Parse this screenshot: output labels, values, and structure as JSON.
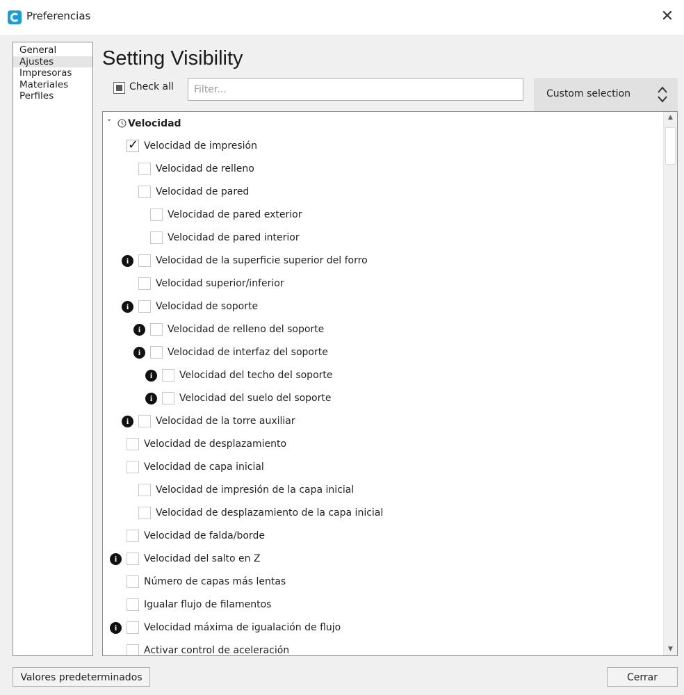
{
  "window": {
    "title": "Preferencias",
    "close_symbol": "✕"
  },
  "sidebar": {
    "items": [
      {
        "label": "General",
        "selected": false
      },
      {
        "label": "Ajustes",
        "selected": true
      },
      {
        "label": "Impresoras",
        "selected": false
      },
      {
        "label": "Materiales",
        "selected": false
      },
      {
        "label": "Perfiles",
        "selected": false
      }
    ]
  },
  "main": {
    "title": "Setting Visibility",
    "check_all_label": "Check all",
    "check_all_state": "partial",
    "filter_placeholder": "Filter...",
    "filter_value": "",
    "preset_value": "Custom selection"
  },
  "category": {
    "label": "Velocidad",
    "expanded": true,
    "icon": "clock-icon"
  },
  "settings": [
    {
      "label": "Velocidad de impresión",
      "checked": true,
      "info": false,
      "depth": 0
    },
    {
      "label": "Velocidad de relleno",
      "checked": false,
      "info": false,
      "depth": 1
    },
    {
      "label": "Velocidad de pared",
      "checked": false,
      "info": false,
      "depth": 1
    },
    {
      "label": "Velocidad de pared exterior",
      "checked": false,
      "info": false,
      "depth": 2
    },
    {
      "label": "Velocidad de pared interior",
      "checked": false,
      "info": false,
      "depth": 2
    },
    {
      "label": "Velocidad de la superficie superior del forro",
      "checked": false,
      "info": true,
      "depth": 1
    },
    {
      "label": "Velocidad superior/inferior",
      "checked": false,
      "info": false,
      "depth": 1
    },
    {
      "label": "Velocidad de soporte",
      "checked": false,
      "info": true,
      "depth": 1
    },
    {
      "label": "Velocidad de relleno del soporte",
      "checked": false,
      "info": true,
      "depth": 2
    },
    {
      "label": "Velocidad de interfaz del soporte",
      "checked": false,
      "info": true,
      "depth": 2
    },
    {
      "label": "Velocidad del techo del soporte",
      "checked": false,
      "info": true,
      "depth": 3
    },
    {
      "label": "Velocidad del suelo del soporte",
      "checked": false,
      "info": true,
      "depth": 3
    },
    {
      "label": "Velocidad de la torre auxiliar",
      "checked": false,
      "info": true,
      "depth": 1
    },
    {
      "label": "Velocidad de desplazamiento",
      "checked": false,
      "info": false,
      "depth": 0
    },
    {
      "label": "Velocidad de capa inicial",
      "checked": false,
      "info": false,
      "depth": 0
    },
    {
      "label": "Velocidad de impresión de la capa inicial",
      "checked": false,
      "info": false,
      "depth": 1
    },
    {
      "label": "Velocidad de desplazamiento de la capa inicial",
      "checked": false,
      "info": false,
      "depth": 1
    },
    {
      "label": "Velocidad de falda/borde",
      "checked": false,
      "info": false,
      "depth": 0
    },
    {
      "label": "Velocidad del salto en Z",
      "checked": false,
      "info": true,
      "depth": 0
    },
    {
      "label": "Número de capas más lentas",
      "checked": false,
      "info": false,
      "depth": 0
    },
    {
      "label": "Igualar flujo de filamentos",
      "checked": false,
      "info": false,
      "depth": 0
    },
    {
      "label": "Velocidad máxima de igualación de flujo",
      "checked": false,
      "info": true,
      "depth": 0
    },
    {
      "label": "Activar control de aceleración",
      "checked": false,
      "info": false,
      "depth": 0
    }
  ],
  "footer": {
    "defaults_label": "Valores predeterminados",
    "close_label": "Cerrar"
  },
  "colors": {
    "accent": "#1a9cd8",
    "info_icon": "#111111"
  }
}
